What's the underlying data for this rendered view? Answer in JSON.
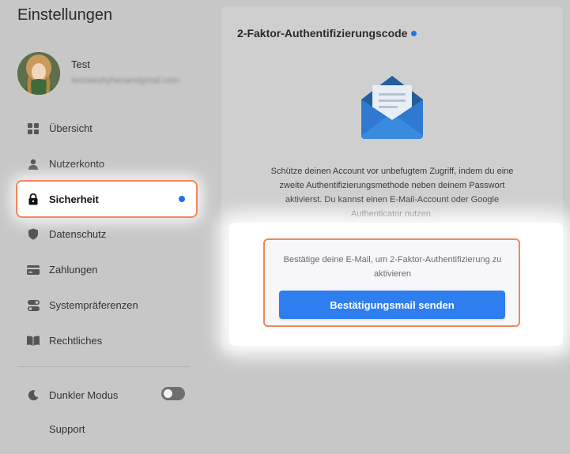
{
  "colors": {
    "accent": "#1e73e8",
    "button": "#2f7ef0",
    "highlight_border": "#f3855b",
    "overlay_bg": "#c7c7c7"
  },
  "sidebar": {
    "title": "Einstellungen",
    "profile": {
      "name": "Test",
      "email": "testaleuhyhenandgmail.com"
    },
    "items": [
      {
        "label": "Übersicht",
        "icon": "grid-icon"
      },
      {
        "label": "Nutzerkonto",
        "icon": "user-icon"
      },
      {
        "label": "Sicherheit",
        "icon": "lock-icon",
        "active": true
      },
      {
        "label": "Datenschutz",
        "icon": "shield-icon"
      },
      {
        "label": "Zahlungen",
        "icon": "credit-card-icon"
      },
      {
        "label": "Systempräferenzen",
        "icon": "toggles-icon"
      },
      {
        "label": "Rechtliches",
        "icon": "book-icon"
      }
    ],
    "dark_mode": {
      "label": "Dunkler Modus",
      "icon": "moon-icon",
      "enabled": false
    },
    "support_label": "Support"
  },
  "main": {
    "title": "2-Faktor-Authentifizierungscode",
    "description": "Schütze deinen Account vor unbefugtem Zugriff, indem du eine zweite Authentifizierungsmethode neben deinem Passwort aktivierst. Du kannst einen E-Mail-Account oder Google Authenticator nutzen.",
    "confirm_text": "Bestätige deine E-Mail, um 2-Faktor-Authentifizierung zu aktivieren",
    "send_button": "Bestätigungsmail senden"
  }
}
